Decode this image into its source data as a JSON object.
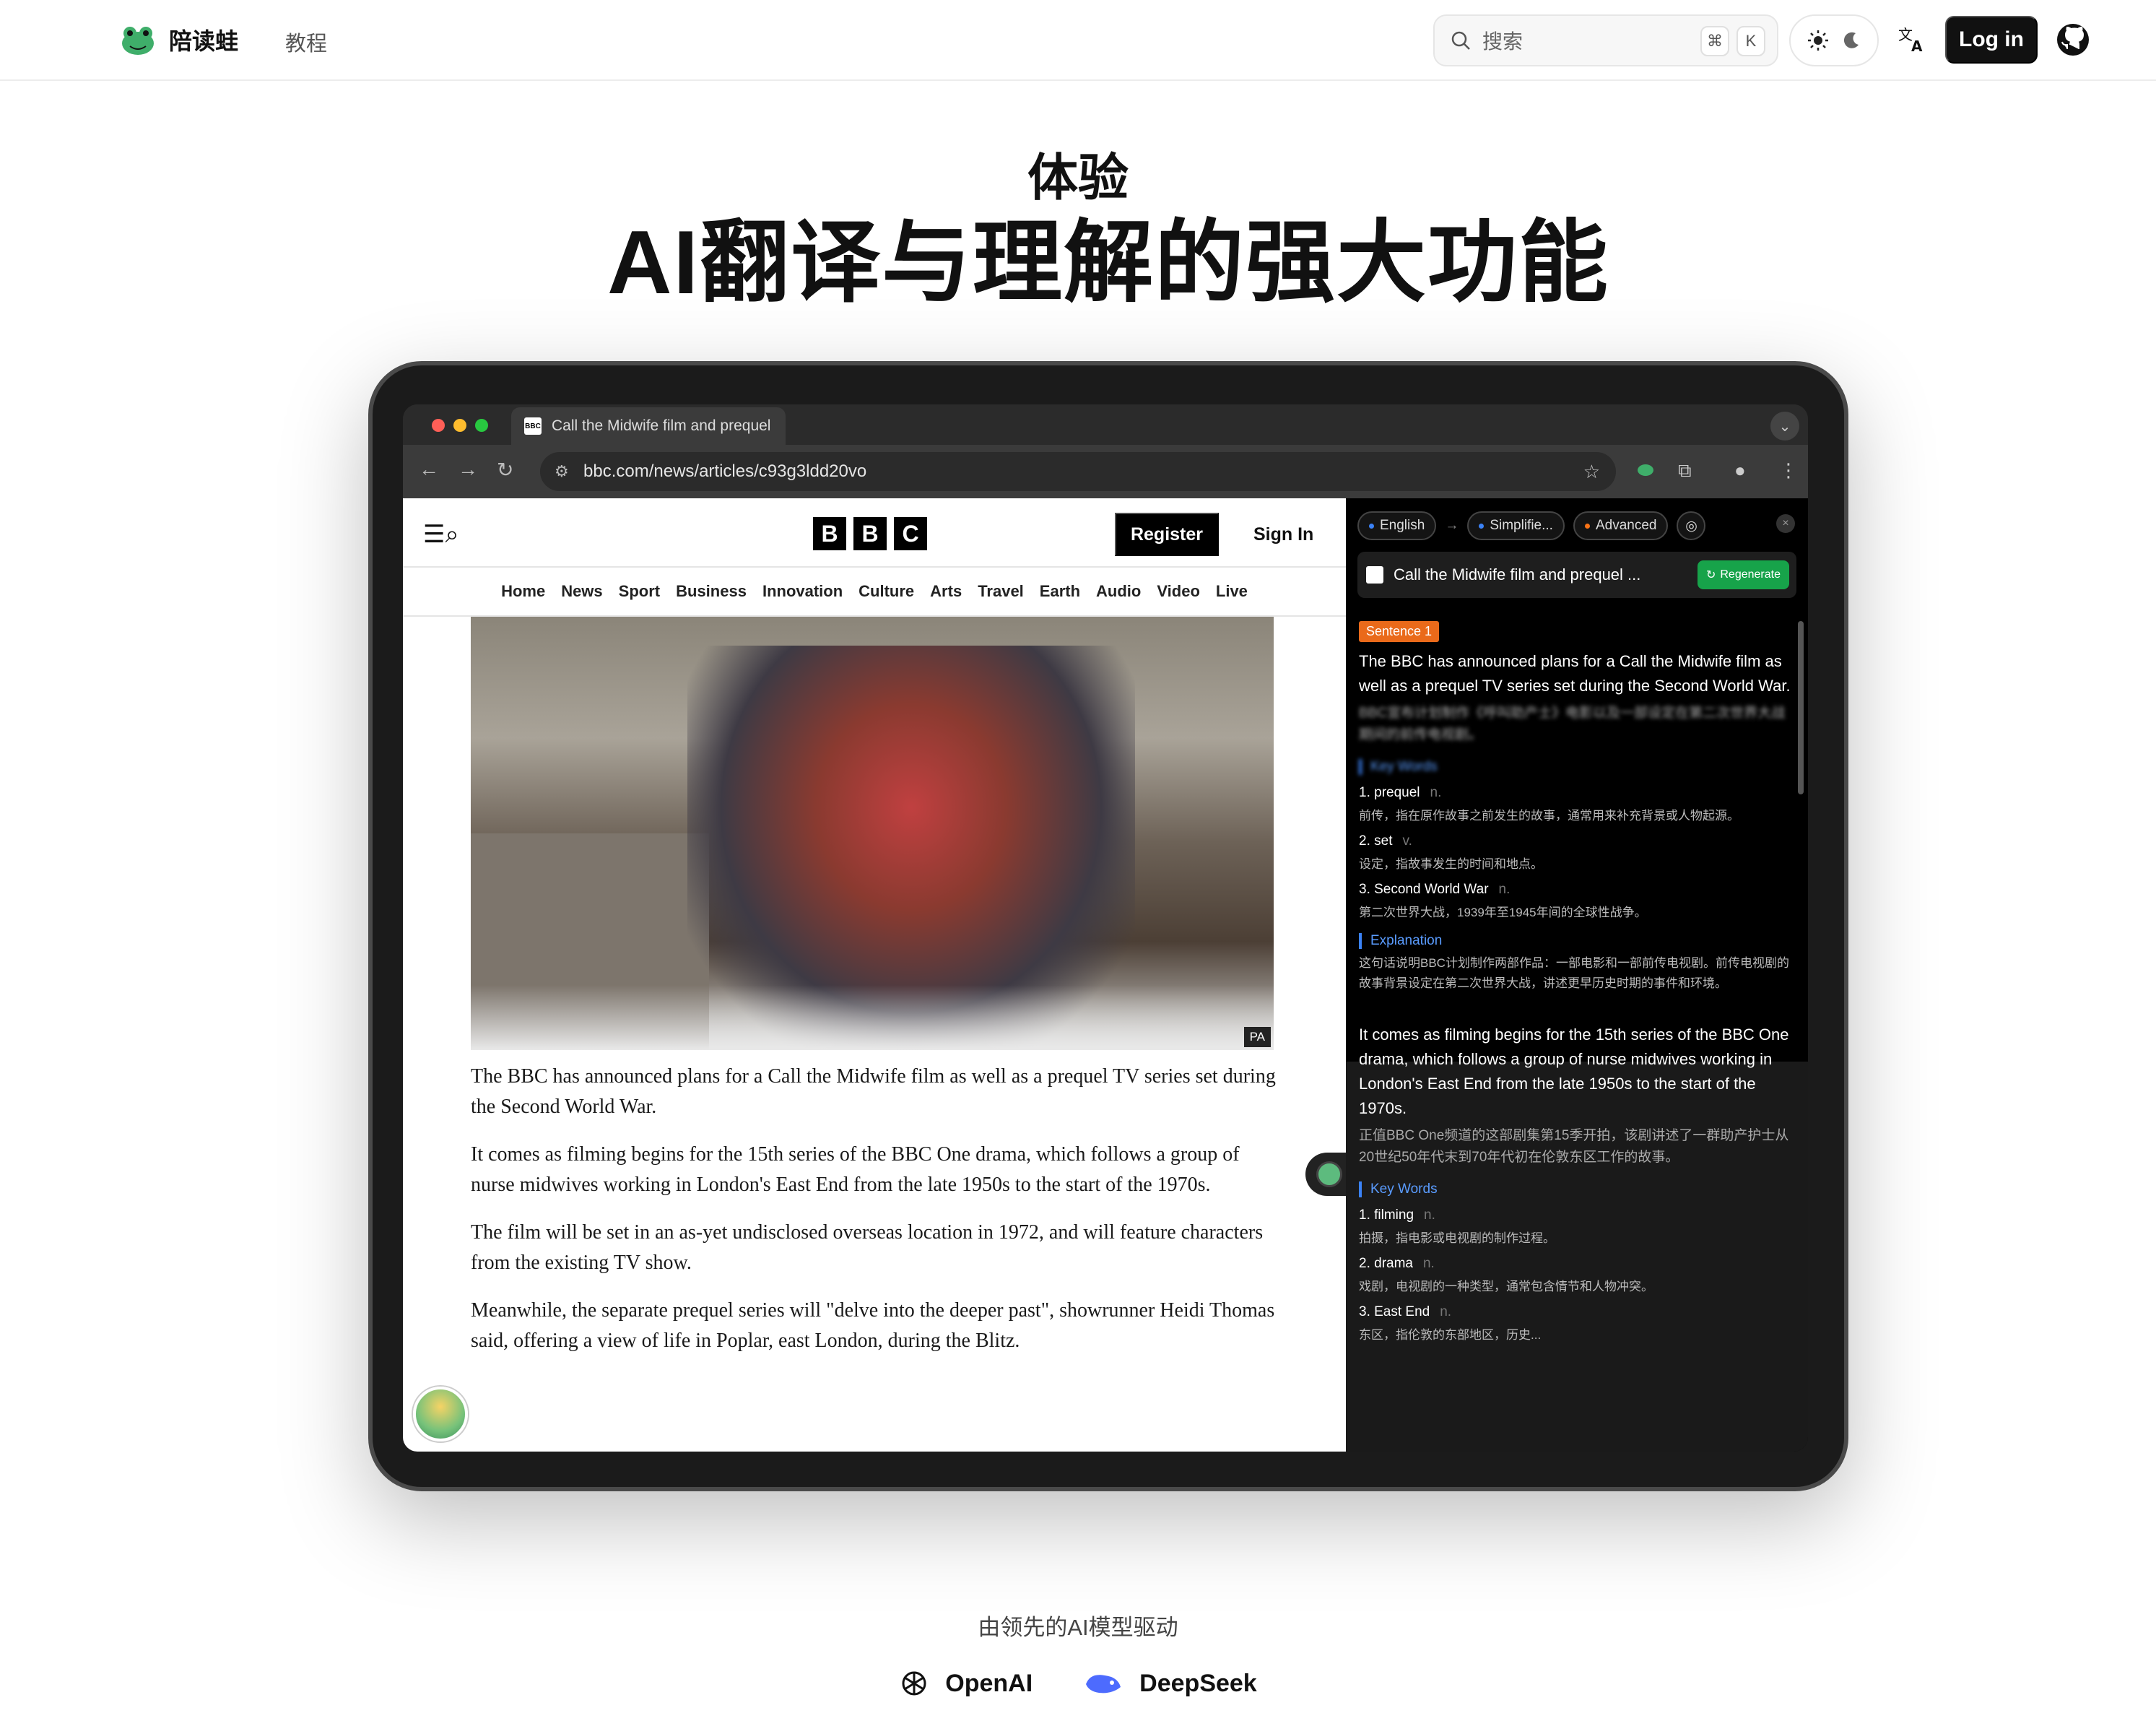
{
  "site": {
    "name": "陪读蛙",
    "nav_tutorial": "教程",
    "search_placeholder": "搜索",
    "kbd_cmd": "⌘",
    "kbd_k": "K",
    "login": "Log in"
  },
  "hero": {
    "line1": "体验",
    "line2": "AI翻译与理解的强大功能"
  },
  "browser": {
    "tab_title": "Call the Midwife film and prequel",
    "url": "bbc.com/news/articles/c93g3ldd20vo",
    "bbc_letters": [
      "B",
      "B",
      "C"
    ],
    "register": "Register",
    "signin": "Sign In",
    "nav": [
      "Home",
      "News",
      "Sport",
      "Business",
      "Innovation",
      "Culture",
      "Arts",
      "Travel",
      "Earth",
      "Audio",
      "Video",
      "Live"
    ],
    "photo_credit": "PA",
    "paragraphs": [
      "The BBC has announced plans for a Call the Midwife film as well as a prequel TV series set during the Second World War.",
      "It comes as filming begins for the 15th series of the BBC One drama, which follows a group of nurse midwives working in London's East End from the late 1950s to the start of the 1970s.",
      "The film will be set in an as-yet undisclosed overseas location in 1972, and will feature characters from the existing TV show.",
      "Meanwhile, the separate prequel series will \"delve into the deeper past\", showrunner Heidi Thomas said, offering a view of life in Poplar, east London, during the Blitz."
    ]
  },
  "panel": {
    "chips": [
      "English",
      "Simplifie...",
      "Advanced"
    ],
    "arrow": "→",
    "title": "Call the Midwife film and prequel ...",
    "regenerate": "Regenerate",
    "sentence1_badge": "Sentence 1",
    "sentence1_en": "The BBC has announced plans for a Call the Midwife film as well as a prequel TV series set during the Second World War.",
    "sentence1_zh": "BBC宣布计划制作《呼叫助产士》电影以及一部设定在第二次世界大战期间的前传电视剧。",
    "keywords_label": "Key Words",
    "words1": [
      {
        "w": "1. prequel",
        "pos": "n.",
        "def": "前传，指在原作故事之前发生的故事，通常用来补充背景或人物起源。"
      },
      {
        "w": "2. set",
        "pos": "v.",
        "def": "设定，指故事发生的时间和地点。"
      },
      {
        "w": "3. Second World War",
        "pos": "n.",
        "def": "第二次世界大战，1939年至1945年间的全球性战争。"
      }
    ],
    "explanation_label": "Explanation",
    "explanation": "这句话说明BBC计划制作两部作品：一部电影和一部前传电视剧。前传电视剧的故事背景设定在第二次世界大战，讲述更早历史时期的事件和环境。",
    "sentence2_en": "It comes as filming begins for the 15th series of the BBC One drama, which follows a group of nurse midwives working in London's East End from the late 1950s to the start of the 1970s.",
    "sentence2_zh": "正值BBC One频道的这部剧集第15季开拍，该剧讲述了一群助产护士从20世纪50年代末到70年代初在伦敦东区工作的故事。",
    "words2": [
      {
        "w": "1. filming",
        "pos": "n.",
        "def": "拍摄，指电影或电视剧的制作过程。"
      },
      {
        "w": "2. drama",
        "pos": "n.",
        "def": "戏剧，电视剧的一种类型，通常包含情节和人物冲突。"
      },
      {
        "w": "3. East End",
        "pos": "n.",
        "def": "东区，指伦敦的东部地区，历史..."
      }
    ]
  },
  "footer": {
    "powered": "由领先的AI模型驱动",
    "providers": [
      "OpenAI",
      "DeepSeek"
    ]
  },
  "colors": {
    "accent_green": "#17a34a",
    "bbc_black": "#000000",
    "sentence_badge": "#ea6a1a",
    "label_blue": "#3b82f6"
  }
}
